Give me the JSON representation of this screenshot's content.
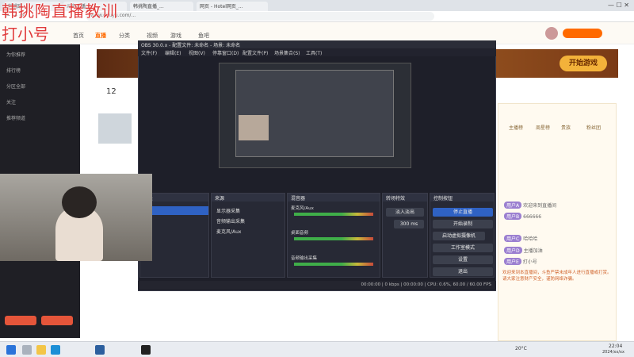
{
  "overlay": {
    "line1": "韩挑陶直播教训",
    "line2": "打小号"
  },
  "browser": {
    "tabs": [
      "韩跳跳...",
      "斗鱼直播...",
      "韩挑陶直播_...",
      "网页 - Hotel网页_..."
    ],
    "url": "www.douyu.com/..."
  },
  "site": {
    "nav": [
      "首页",
      "直播",
      "分类",
      "视频",
      "游戏",
      "鱼吧"
    ],
    "left_nav": [
      "为你推荐",
      "排行榜",
      "分区全部",
      "关注",
      "推荐频道"
    ],
    "follow_count": "12",
    "banner_button": "开始游戏"
  },
  "obs": {
    "title": "OBS 30.0.x - 配置文件: 未命名 - 场景: 未命名",
    "menu": [
      "文件(F)",
      "编辑(E)",
      "视图(V)",
      "停靠窗口(D)",
      "配置文件(P)",
      "场景集合(S)",
      "工具(T)",
      "帮助(H)"
    ],
    "docks": {
      "scenes": "场景",
      "sources": "来源",
      "mixer": "混音器",
      "transitions": "转场特效",
      "controls": "控制按钮"
    },
    "sources": [
      "显示器采集",
      "音频输出采集",
      "麦克风/Aux"
    ],
    "mixer_tracks": [
      "麦克风/Aux",
      "桌面音频",
      "音频输出采集"
    ],
    "transition_value": "淡入淡出",
    "duration": "300 ms",
    "controls": [
      "停止直播",
      "开始录制",
      "启动虚拟摄像机",
      "工作室模式",
      "设置",
      "退出"
    ],
    "status": "00:00:00 | 0 kbps | 00:00:00 | CPU: 0.6%, 60.00 / 60.00 FPS"
  },
  "right_panel": {
    "tabs": [
      "主播榜",
      "周星榜",
      "贵族",
      "粉丝团"
    ],
    "messages": [
      {
        "user": "用户A",
        "text": "欢迎来到直播间"
      },
      {
        "user": "用户B",
        "text": "666666"
      },
      {
        "user": "用户C",
        "text": "哈哈哈"
      },
      {
        "user": "用户D",
        "text": "主播加油"
      },
      {
        "user": "用户E",
        "text": "打小号"
      }
    ],
    "notice": "欢迎来到本直播间，斗鱼严禁未成年人进行直播或打赏。请大家注意财产安全，谨防网络诈骗。"
  },
  "taskbar": {
    "time": "22:04",
    "date": "2024/xx/xx",
    "weather": "20°C"
  }
}
